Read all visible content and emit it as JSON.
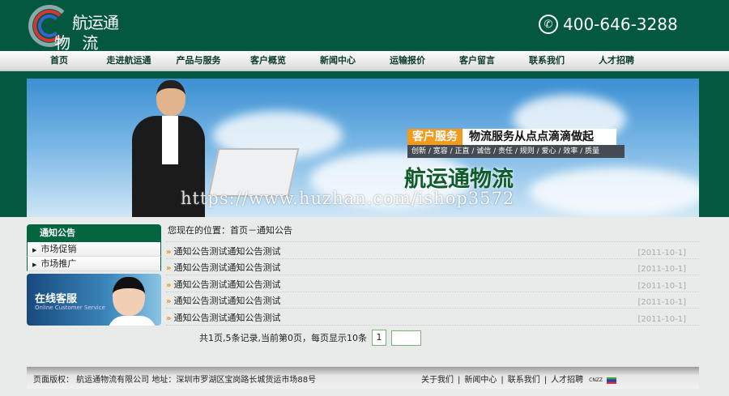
{
  "header": {
    "logo_line1": "航运通",
    "logo_line2": "物 流",
    "logo_mark": "HYT",
    "phone": "400-646-3288"
  },
  "nav": [
    "首页",
    "走进航运通",
    "产品与服务",
    "客户概览",
    "新闻中心",
    "运输报价",
    "客户留言",
    "联系我们",
    "人才招聘"
  ],
  "banner": {
    "tag": "客户服务",
    "slogan": "物流服务从点点滴滴做起",
    "values": "创新 / 宽容 / 正直 / 诚信 / 责任 / 规则 / 爱心 / 效率 / 质量",
    "name": "航运通物流",
    "watermark": "https://www.huzhan.com/ishop3572"
  },
  "sidebar": {
    "title": "通知公告",
    "items": [
      "市场促销",
      "市场推广"
    ],
    "service_title": "在线客服",
    "service_subtitle": "Online Customer Service"
  },
  "content": {
    "breadcrumb": "您现在的位置：首页－通知公告",
    "rows": [
      {
        "title": "通知公告测试通知公告测试",
        "date": "[2011-10-1]"
      },
      {
        "title": "通知公告测试通知公告测试",
        "date": "[2011-10-1]"
      },
      {
        "title": "通知公告测试通知公告测试",
        "date": "[2011-10-1]"
      },
      {
        "title": "通知公告测试通知公告测试",
        "date": "[2011-10-1]"
      },
      {
        "title": "通知公告测试通知公告测试",
        "date": "[2011-10-1]"
      }
    ],
    "pager_text": "共1页,5条记录,当前第0页，每页显示10条",
    "page": "1",
    "page_input": ""
  },
  "footer": {
    "copyright": "页面版权： 航运通物流有限公司  地址：深圳市罗湖区宝岗路长城货运市场88号",
    "links": [
      "关于我们",
      "新闻中心",
      "联系我们",
      "人才招聘"
    ],
    "sep": "|",
    "cnzz": "CNZZ"
  },
  "colors": {
    "brand": "#03583f",
    "accent": "#f39a1c"
  }
}
